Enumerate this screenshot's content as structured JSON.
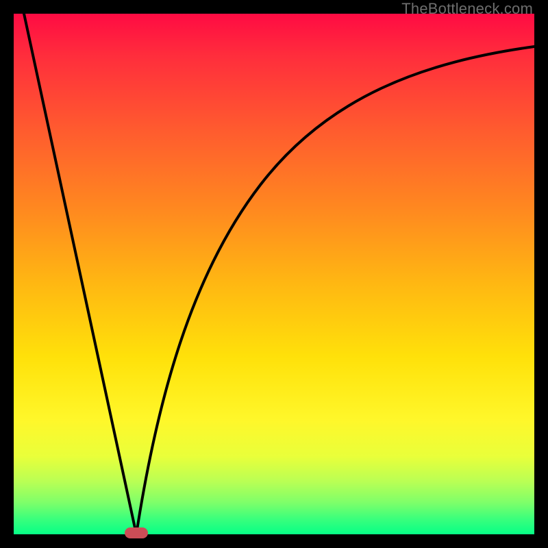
{
  "watermark": "TheBottleneck.com",
  "colors": {
    "frame": "#000000",
    "curve": "#000000",
    "marker": "#cc4d57"
  },
  "chart_data": {
    "type": "line",
    "title": "",
    "xlabel": "",
    "ylabel": "",
    "xlim": [
      0,
      100
    ],
    "ylim": [
      0,
      100
    ],
    "grid": false,
    "series": [
      {
        "name": "left-branch",
        "x": [
          2,
          5,
          8,
          11,
          14,
          17,
          20,
          22,
          23.5
        ],
        "values": [
          100,
          86,
          72,
          58,
          44,
          30,
          16,
          6,
          0
        ]
      },
      {
        "name": "right-branch",
        "x": [
          23.5,
          26,
          30,
          36,
          44,
          54,
          66,
          80,
          90,
          100
        ],
        "values": [
          0,
          14,
          32,
          50,
          64,
          75,
          83,
          89,
          92,
          94
        ]
      }
    ],
    "marker": {
      "x": 23.5,
      "y": 0,
      "shape": "pill"
    },
    "background": "vertical-gradient red→orange→yellow→green"
  }
}
